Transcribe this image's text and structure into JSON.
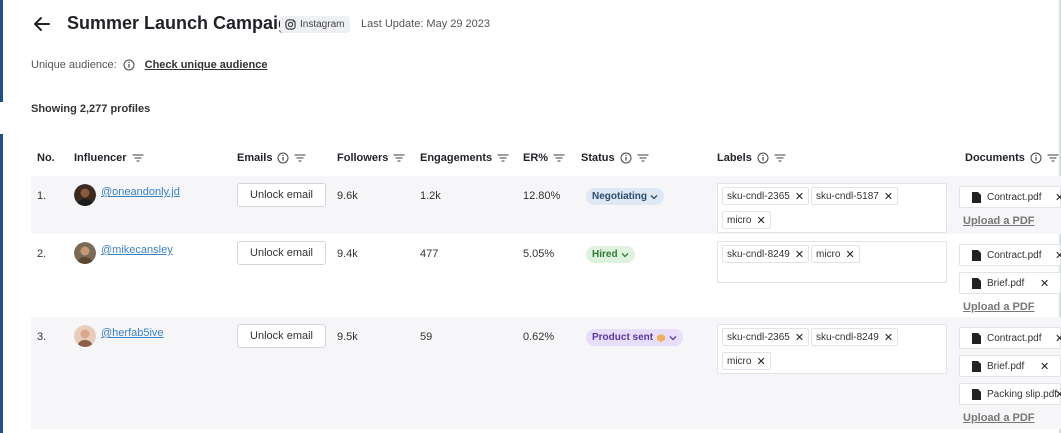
{
  "header": {
    "title": "Summer Launch Campaign",
    "platform": "Instagram",
    "last_update": "Last Update: May 29 2023"
  },
  "audience": {
    "label": "Unique audience:",
    "link": "Check unique audience"
  },
  "showing": "Showing 2,277 profiles",
  "columns": {
    "no": "No.",
    "influencer": "Influencer",
    "emails": "Emails",
    "followers": "Followers",
    "engagements": "Engagements",
    "er": "ER%",
    "status": "Status",
    "labels": "Labels",
    "documents": "Documents"
  },
  "rows": [
    {
      "no": "1.",
      "handle": "@oneandonly.jd",
      "email_button": "Unlock email",
      "followers": "9.6k",
      "engagements": "1.2k",
      "er": "12.80%",
      "status": "Negotiating",
      "labels": [
        "sku-cndl-2365",
        "sku-cndl-5187",
        "micro"
      ],
      "documents": [
        "Contract.pdf"
      ],
      "upload": "Upload a PDF"
    },
    {
      "no": "2.",
      "handle": "@mikecansley",
      "email_button": "Unlock email",
      "followers": "9.4k",
      "engagements": "477",
      "er": "5.05%",
      "status": "Hired",
      "labels": [
        "sku-cndl-8249",
        "micro"
      ],
      "documents": [
        "Contract.pdf",
        "Brief.pdf"
      ],
      "upload": "Upload a PDF"
    },
    {
      "no": "3.",
      "handle": "@herfab5ive",
      "email_button": "Unlock email",
      "followers": "9.5k",
      "engagements": "59",
      "er": "0.62%",
      "status": "Product sent",
      "labels": [
        "sku-cndl-2365",
        "sku-cndl-8249",
        "micro"
      ],
      "documents": [
        "Contract.pdf",
        "Brief.pdf",
        "Packing slip.pdf"
      ],
      "upload": "Upload a PDF"
    }
  ],
  "icons": {
    "back": "arrow-left-icon",
    "platform": "instagram-icon",
    "info": "info-icon",
    "filter": "filter-icon",
    "chevron": "chevron-down-icon",
    "file": "file-icon",
    "remove": "close-icon"
  },
  "colors": {
    "accent": "#1e4f8a",
    "link": "#3b82c4",
    "status_negotiating_bg": "#dde8f4",
    "status_hired_bg": "#dff1df",
    "status_product_sent_bg": "#e8defa"
  }
}
